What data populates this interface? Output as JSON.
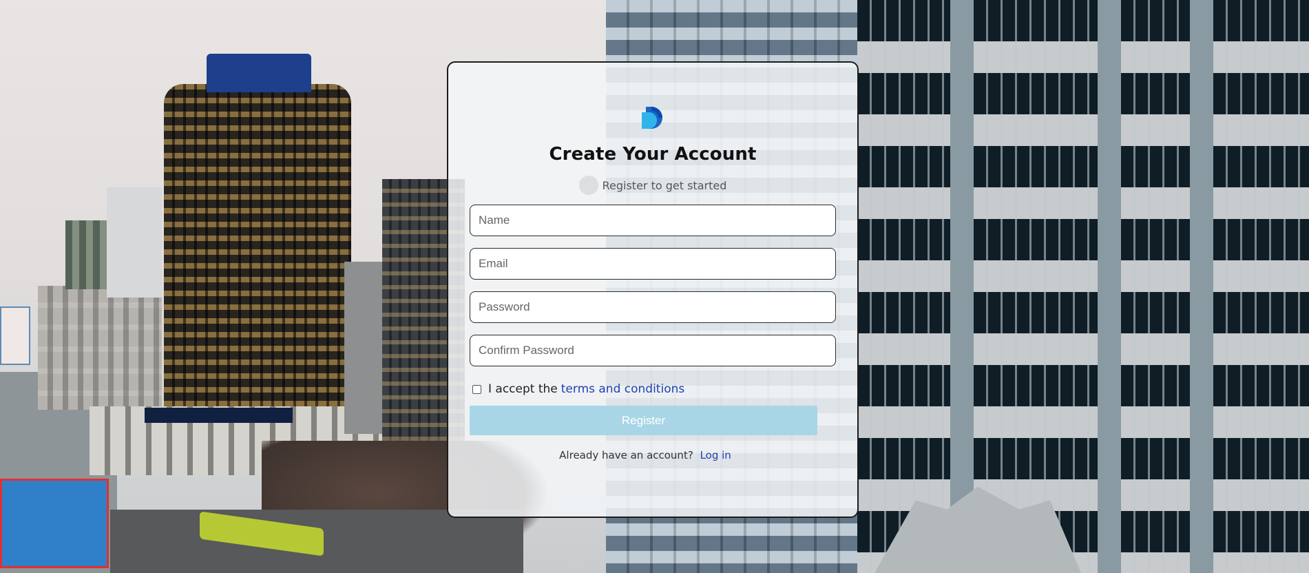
{
  "page": {
    "accent_color": "#1f3fb0",
    "button_color": "#a9d6e6"
  },
  "card": {
    "logo_icon": "brand-d-logo-icon",
    "title": "Create Your Account",
    "subtitle": "Register to get started"
  },
  "form": {
    "name_placeholder": "Name",
    "email_placeholder": "Email",
    "password_placeholder": "Password",
    "confirm_password_placeholder": "Confirm Password",
    "terms_prefix": "I accept the",
    "terms_link": "terms and conditions",
    "register_label": "Register"
  },
  "footer": {
    "prompt": "Already have an account?",
    "login_link": "Log in"
  }
}
